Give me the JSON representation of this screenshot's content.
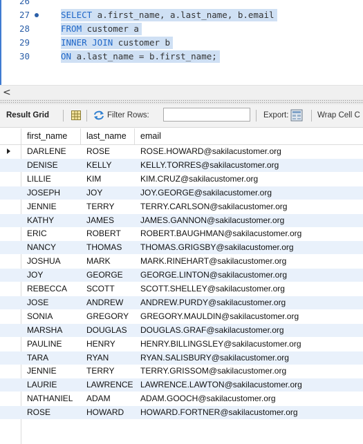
{
  "editor": {
    "lines": [
      {
        "num": "26",
        "parts": []
      },
      {
        "num": "27",
        "marker": true,
        "parts": [
          [
            "kw",
            "SELECT"
          ],
          [
            "tx",
            " a.first_name, a.last_name, b.email"
          ]
        ]
      },
      {
        "num": "28",
        "parts": [
          [
            "kw",
            "FROM"
          ],
          [
            "tx",
            " customer a"
          ]
        ]
      },
      {
        "num": "29",
        "parts": [
          [
            "kw",
            "INNER JOIN"
          ],
          [
            "tx",
            " customer b"
          ]
        ]
      },
      {
        "num": "30",
        "parts": [
          [
            "kw",
            "ON"
          ],
          [
            "tx",
            " a.last_name = b.first_name;"
          ]
        ]
      }
    ]
  },
  "scrollbar": {
    "left_arrow": "<"
  },
  "toolbar": {
    "result_grid_label": "Result Grid",
    "filter_label": "Filter Rows:",
    "filter_value": "",
    "export_label": "Export:",
    "wrap_label": "Wrap Cell C"
  },
  "grid": {
    "columns": [
      "first_name",
      "last_name",
      "email"
    ],
    "rows": [
      [
        "DARLENE",
        "ROSE",
        "ROSE.HOWARD@sakilacustomer.org"
      ],
      [
        "DENISE",
        "KELLY",
        "KELLY.TORRES@sakilacustomer.org"
      ],
      [
        "LILLIE",
        "KIM",
        "KIM.CRUZ@sakilacustomer.org"
      ],
      [
        "JOSEPH",
        "JOY",
        "JOY.GEORGE@sakilacustomer.org"
      ],
      [
        "JENNIE",
        "TERRY",
        "TERRY.CARLSON@sakilacustomer.org"
      ],
      [
        "KATHY",
        "JAMES",
        "JAMES.GANNON@sakilacustomer.org"
      ],
      [
        "ERIC",
        "ROBERT",
        "ROBERT.BAUGHMAN@sakilacustomer.org"
      ],
      [
        "NANCY",
        "THOMAS",
        "THOMAS.GRIGSBY@sakilacustomer.org"
      ],
      [
        "JOSHUA",
        "MARK",
        "MARK.RINEHART@sakilacustomer.org"
      ],
      [
        "JOY",
        "GEORGE",
        "GEORGE.LINTON@sakilacustomer.org"
      ],
      [
        "REBECCA",
        "SCOTT",
        "SCOTT.SHELLEY@sakilacustomer.org"
      ],
      [
        "JOSE",
        "ANDREW",
        "ANDREW.PURDY@sakilacustomer.org"
      ],
      [
        "SONIA",
        "GREGORY",
        "GREGORY.MAULDIN@sakilacustomer.org"
      ],
      [
        "MARSHA",
        "DOUGLAS",
        "DOUGLAS.GRAF@sakilacustomer.org"
      ],
      [
        "PAULINE",
        "HENRY",
        "HENRY.BILLINGSLEY@sakilacustomer.org"
      ],
      [
        "TARA",
        "RYAN",
        "RYAN.SALISBURY@sakilacustomer.org"
      ],
      [
        "JENNIE",
        "TERRY",
        "TERRY.GRISSOM@sakilacustomer.org"
      ],
      [
        "LAURIE",
        "LAWRENCE",
        "LAWRENCE.LAWTON@sakilacustomer.org"
      ],
      [
        "NATHANIEL",
        "ADAM",
        "ADAM.GOOCH@sakilacustomer.org"
      ],
      [
        "ROSE",
        "HOWARD",
        "HOWARD.FORTNER@sakilacustomer.org"
      ]
    ]
  },
  "colors": {
    "keyword": "#1f67c8",
    "selection": "#cfe0f4",
    "alt_row": "#e9f1fb"
  }
}
